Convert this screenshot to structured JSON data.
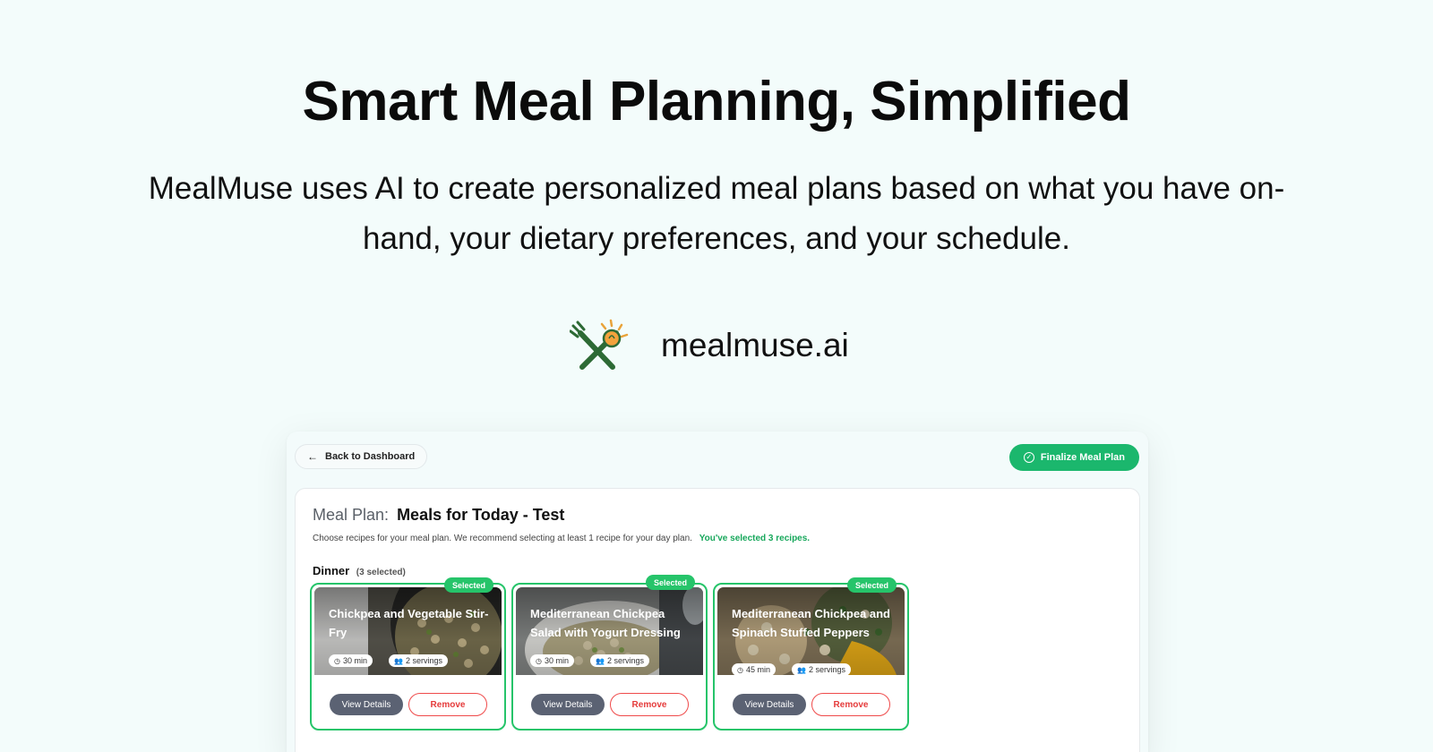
{
  "hero": {
    "title": "Smart Meal Planning, Simplified",
    "subtitle": "MealMuse uses AI to create personalized meal plans based on what you have on-hand, your dietary preferences, and your schedule.",
    "brand_name": "mealmuse.ai",
    "logo_icon": "fork-knife-lightbulb-icon"
  },
  "app": {
    "back_label": "Back to Dashboard",
    "finalize_label": "Finalize Meal Plan",
    "plan_label": "Meal Plan:",
    "plan_name": "Meals for Today - Test",
    "description": "Choose recipes for your meal plan. We recommend selecting at least 1 recipe for your day plan.",
    "selected_note": "You've selected 3 recipes.",
    "section_title": "Dinner",
    "section_count": "(3 selected)"
  },
  "recipes": [
    {
      "title": "Chickpea and Vegetable Stir-Fry",
      "time": "30 min",
      "servings": "2 servings",
      "badge": "Selected",
      "view": "View Details",
      "remove": "Remove"
    },
    {
      "title": "Mediterranean Chickpea Salad with Yogurt Dressing",
      "time": "30 min",
      "servings": "2 servings",
      "badge": "Selected",
      "view": "View Details",
      "remove": "Remove"
    },
    {
      "title": "Mediterranean Chickpea and Spinach Stuffed Peppers",
      "time": "45 min",
      "servings": "2 servings",
      "badge": "Selected",
      "view": "View Details",
      "remove": "Remove"
    }
  ],
  "colors": {
    "accent": "#1bb76d",
    "selected_border": "#26c46a",
    "remove": "#e53b3b",
    "view_btn": "#5b6273"
  }
}
